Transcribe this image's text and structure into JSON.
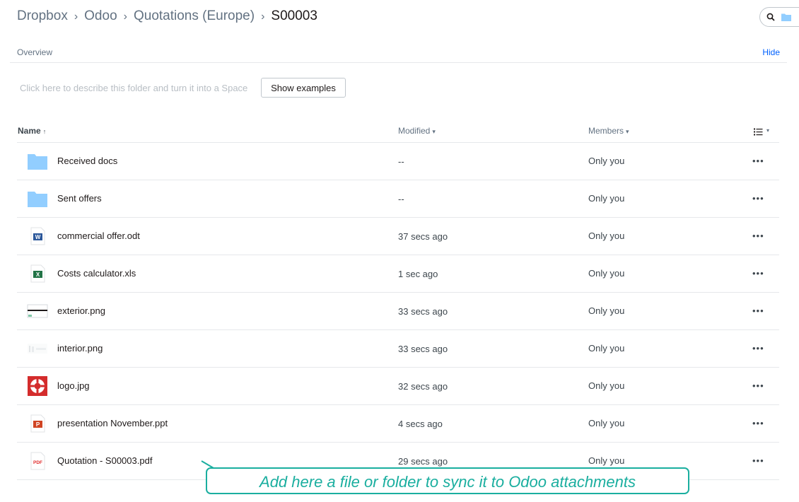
{
  "breadcrumb": {
    "items": [
      "Dropbox",
      "Odoo",
      "Quotations (Europe)"
    ],
    "separator": "›",
    "current": "S00003"
  },
  "overview": {
    "label": "Overview",
    "hide_label": "Hide"
  },
  "description": {
    "placeholder": "Click here to describe this folder and turn it into a Space",
    "show_examples_label": "Show examples"
  },
  "table": {
    "columns": {
      "name": "Name",
      "name_arrow": "↑",
      "modified": "Modified",
      "members": "Members",
      "sort_caret": "▾"
    },
    "rows": [
      {
        "name": "Received docs",
        "modified": "--",
        "members": "Only you",
        "icon": "folder-icon"
      },
      {
        "name": "Sent offers",
        "modified": "--",
        "members": "Only you",
        "icon": "folder-icon"
      },
      {
        "name": "commercial offer.odt",
        "modified": "37 secs ago",
        "members": "Only you",
        "icon": "word-doc-icon"
      },
      {
        "name": "Costs calculator.xls",
        "modified": "1 sec ago",
        "members": "Only you",
        "icon": "excel-icon"
      },
      {
        "name": "exterior.png",
        "modified": "33 secs ago",
        "members": "Only you",
        "icon": "image-thumbnail-icon"
      },
      {
        "name": "interior.png",
        "modified": "33 secs ago",
        "members": "Only you",
        "icon": "image-thumbnail-icon"
      },
      {
        "name": "logo.jpg",
        "modified": "32 secs ago",
        "members": "Only you",
        "icon": "lifebuoy-logo-icon"
      },
      {
        "name": "presentation November.ppt",
        "modified": "4 secs ago",
        "members": "Only you",
        "icon": "powerpoint-icon"
      },
      {
        "name": "Quotation - S00003.pdf",
        "modified": "29 secs ago",
        "members": "Only you",
        "icon": "pdf-icon"
      }
    ],
    "more_label": "•••"
  },
  "callout": {
    "text": "Add here a file or folder to sync it to Odoo attachments"
  },
  "colors": {
    "accent": "#0061fe",
    "folder": "#92ceff",
    "callout": "#1aae9f",
    "word": "#2b579a",
    "excel": "#217346",
    "powerpoint": "#d04423",
    "pdf": "#e02c2c"
  }
}
